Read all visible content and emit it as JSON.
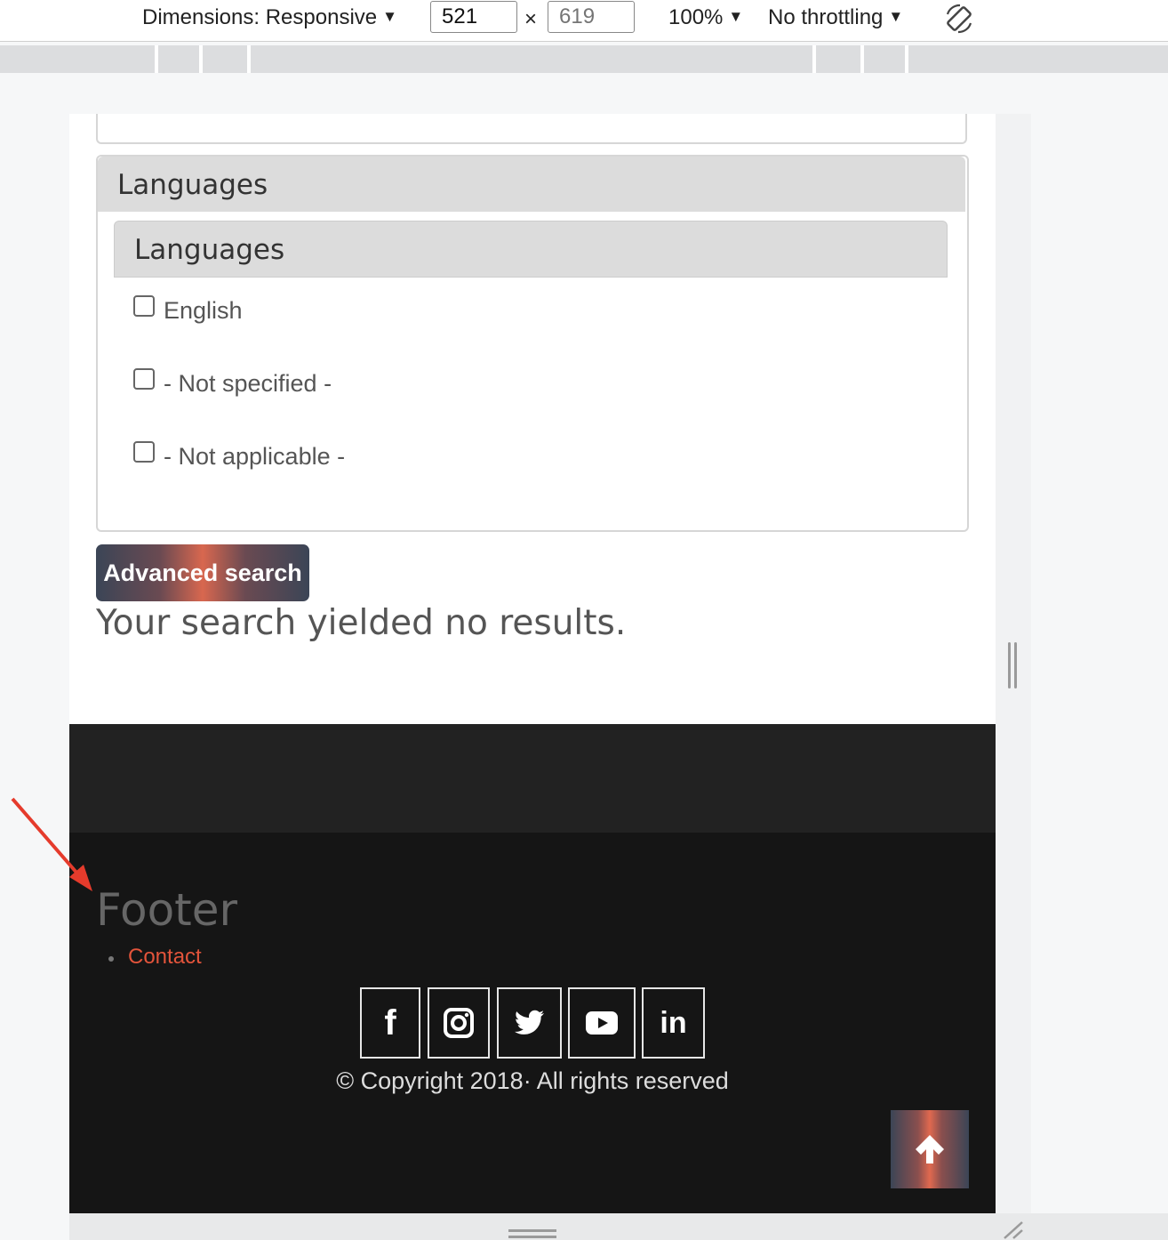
{
  "devtools": {
    "dimensions_label": "Dimensions: Responsive",
    "width_value": "521",
    "times": "×",
    "height_value": "619",
    "zoom_label": "100%",
    "throttling_label": "No throttling",
    "caret": "▼",
    "rotate_icon": "rotate-icon"
  },
  "page": {
    "fieldset_legend": "Languages",
    "inner_legend": "Languages",
    "options": [
      {
        "label": "English",
        "checked": false
      },
      {
        "label": "- Not specified -",
        "checked": false
      },
      {
        "label": "- Not applicable -",
        "checked": false
      }
    ],
    "advanced_search_label": "Advanced search",
    "no_results_text": "Your search yielded no results."
  },
  "footer": {
    "title": "Footer",
    "links": [
      "Contact"
    ],
    "social": [
      {
        "icon": "facebook-icon",
        "glyph": "f"
      },
      {
        "icon": "instagram-icon",
        "glyph": ""
      },
      {
        "icon": "twitter-icon",
        "glyph": ""
      },
      {
        "icon": "youtube-icon",
        "glyph": ""
      },
      {
        "icon": "linkedin-icon",
        "glyph": "in"
      }
    ],
    "copyright": "© Copyright 2018· All rights reserved",
    "back_to_top_icon": "arrow-up-icon"
  },
  "colors": {
    "link": "#e3543b",
    "footer_bg": "#151515",
    "footer_top_bg": "#222222",
    "annotation": "#e53b2c"
  }
}
